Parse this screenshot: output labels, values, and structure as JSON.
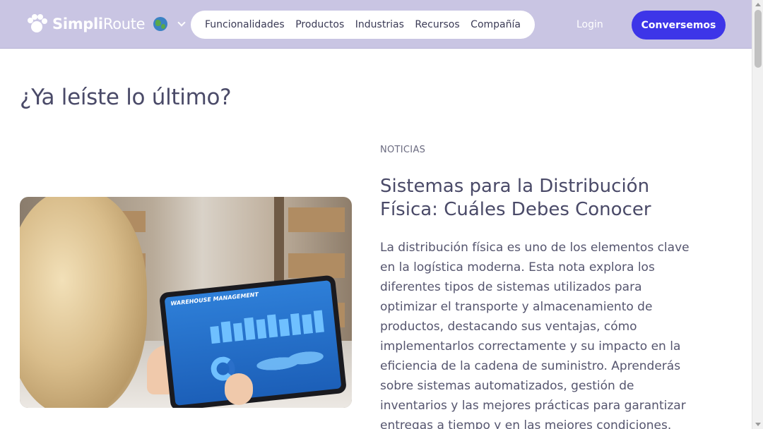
{
  "header": {
    "logo": {
      "bold": "Simpli",
      "light": "Route"
    },
    "globe_icon": "globe-icon",
    "nav": [
      {
        "label": "Funcionalidades"
      },
      {
        "label": "Productos"
      },
      {
        "label": "Industrias"
      },
      {
        "label": "Recursos"
      },
      {
        "label": "Compañía"
      }
    ],
    "login_label": "Login",
    "cta_label": "Conversemos"
  },
  "section": {
    "title": "¿Ya leíste lo último?"
  },
  "article": {
    "image": {
      "screen_title": "WAREHOUSE MANAGEMENT"
    },
    "category": "NOTICIAS",
    "title": "Sistemas para la Distribución Física: Cuáles Debes Conocer",
    "excerpt": "La distribución física es uno de los elementos clave en la logística moderna. Esta nota explora los diferentes tipos de sistemas utilizados para optimizar el transporte y almacenamiento de productos, destacando sus ventajas, cómo implementarlos correctamente y su impacto en la eficiencia de la cadena de suministro. Aprenderás sobre sistemas automatizados, gestión de inventarios y las mejores prácticas para garantizar entregas a tiempo y en las mejores condiciones."
  },
  "colors": {
    "header_bg": "#c9c5e3",
    "cta_bg": "#3d35e8",
    "text": "#4a4a68"
  }
}
